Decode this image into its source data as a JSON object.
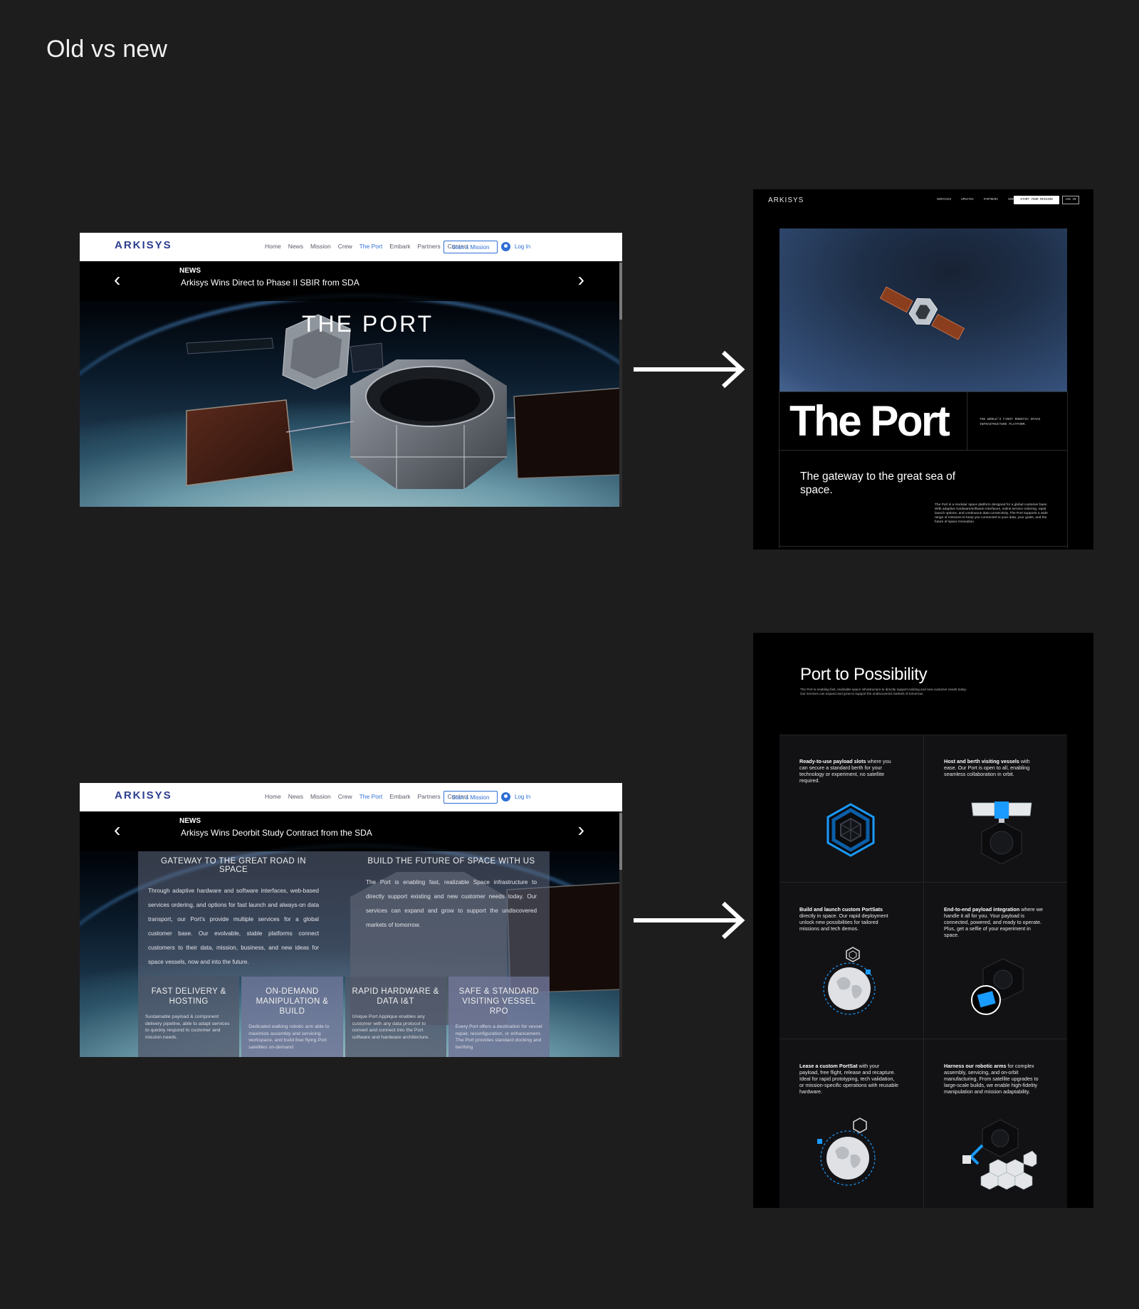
{
  "page": {
    "heading": "Old vs new"
  },
  "old_site": {
    "brand": "ARKISYS",
    "nav": [
      "Home",
      "News",
      "Mission",
      "Crew",
      "The Port",
      "Embark",
      "Partners",
      "Contact"
    ],
    "active_nav": "The Port",
    "start_button": "Start a Mission",
    "login": "Log In",
    "news_kicker": "NEWS",
    "slide1": {
      "news_title": "Arkisys Wins Direct to Phase II SBIR from SDA",
      "hero_title": "THE PORT"
    },
    "slide2": {
      "news_title": "Arkisys Wins Deorbit Study Contract from the SDA",
      "intro": [
        {
          "heading": "GATEWAY TO THE GREAT ROAD IN SPACE",
          "body": "Through adaptive hardware and software interfaces, web-based services ordering, and options for fast launch and always-on data transport, our Port's provide multiple services for a global customer base. Our evolvable, stable platforms connect customers to their data, mission, business, and new ideas for space vessels, now and into the future."
        },
        {
          "heading": "BUILD THE FUTURE OF SPACE WITH US",
          "body": "The Port is enabling fast, realizable Space infrastructure to directly support existing and new customer needs today. Our services can expand and grow to support the undiscovered markets of tomorrow."
        }
      ],
      "features": [
        {
          "title": "FAST DELIVERY & HOSTING",
          "body": "Sustainable payload & component delivery pipeline, able to adapt services to quickly respond to customer and mission needs."
        },
        {
          "title": "ON-DEMAND MANIPULATION & BUILD",
          "body": "Dedicated walking robotic arm able to maximize assembly and servicing workspace, and build free flying Port satellites on-demand"
        },
        {
          "title": "RAPID HARDWARE & DATA I&T",
          "body": "Unique Port Applique enables any customer with any data protocol to convert and connect into the Port software and hardware architecture."
        },
        {
          "title": "SAFE & STANDARD VISITING VESSEL RPO",
          "body": "Every Port offers a destination for vessel repair, reconfiguration, or enhancement. The Port provides standard docking and berthing"
        }
      ]
    }
  },
  "new_site": {
    "logo": "ARKISYS",
    "nav": [
      "SERVICES",
      "UPDATES",
      "PARTNERS",
      "ABOUT"
    ],
    "cta": "START YOUR MISSION",
    "login": "LOG IN",
    "hero_title": "The Port",
    "tagline": "THE WORLD'S FIRST ROBOTIC SPACE INFRASTRUCTURE PLATFORM.",
    "subhead": "The gateway to the great sea of space.",
    "blurb": "The Port is a modular space platform designed for a global customer base. With adaptive hardware/software interfaces, online service ordering, rapid launch options, and continuous data connectivity, The Port supports a wide range of missions to keep you connected to your data, your goals, and the future of space innovation.",
    "possibility": {
      "title": "Port to Possibility",
      "blurb": "The Port is enabling fast, realizable space infrastructure to directly support existing and new customer needs today. Our services can expand and grow to support the undiscovered markets of tomorrow.",
      "cells": [
        {
          "lead": "Ready-to-use payload slots",
          "text": " where you can secure a standard berth for your technology or experiment, no satellite required."
        },
        {
          "lead": "Host and berth visiting vessels",
          "text": " with ease. Our Port is open to all, enabling seamless collaboration in orbit."
        },
        {
          "lead": "Build and launch custom PortSats",
          "text": " directly in space. Our rapid deployment unlock new possibilities for tailored missions and tech demos."
        },
        {
          "lead": "End-to-end payload integration",
          "text": " where we handle it all for you. Your payload is connected, powered, and ready to operate. Plus, get a selfie of your experiment in space."
        },
        {
          "lead": "Lease a custom PortSat",
          "text": " with your payload, free flight, release and recapture. Ideal for rapid prototyping, tech validation, or mission-specific operations with reusable hardware."
        },
        {
          "lead": "Harness our robotic arms",
          "text": " for complex assembly, servicing, and on-orbit manufacturing. From satellite upgrades to large-scale builds, we enable high-fidelity manipulation and mission adaptability."
        }
      ]
    }
  },
  "colors": {
    "background": "#1d1d1e",
    "accent_blue": "#2f6fd6",
    "new_accent": "#1a9bff"
  }
}
